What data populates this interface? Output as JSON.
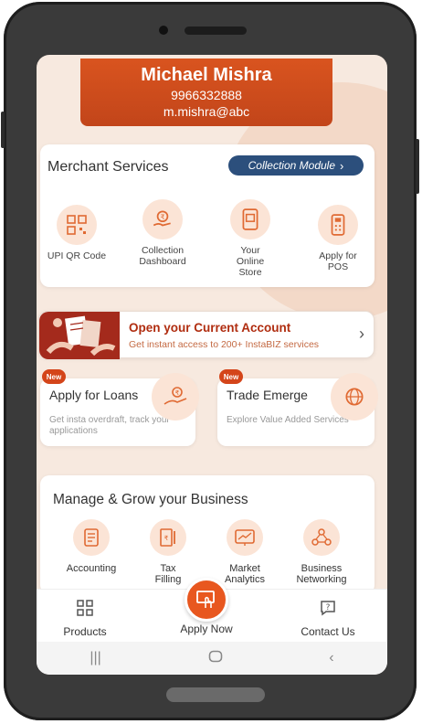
{
  "profile": {
    "name": "Michael Mishra",
    "phone": "9966332888",
    "email": "m.mishra@abc"
  },
  "merchant_services": {
    "title": "Merchant Services",
    "collection_button": "Collection Module",
    "items": [
      {
        "label": "UPI QR Code",
        "icon": "qr-code-icon"
      },
      {
        "label": "Collection Dashboard",
        "icon": "collection-dashboard-icon"
      },
      {
        "label": "Your Online Store",
        "icon": "online-store-icon"
      },
      {
        "label": "Apply for POS",
        "icon": "pos-machine-icon"
      }
    ]
  },
  "current_account": {
    "title": "Open your Current Account",
    "subtitle": "Get instant access to 200+ InstaBIZ services"
  },
  "loans": {
    "badge": "New",
    "title": "Apply for Loans",
    "subtitle": "Get insta overdraft, track your applications"
  },
  "trade": {
    "badge": "New",
    "title": "Trade Emerge",
    "subtitle": "Explore Value Added Services"
  },
  "grow": {
    "title": "Manage & Grow your Business",
    "items": [
      {
        "label": "Accounting",
        "icon": "accounting-icon"
      },
      {
        "label": "Tax Filling",
        "icon": "tax-filing-icon"
      },
      {
        "label": "Market Analytics",
        "icon": "market-analytics-icon"
      },
      {
        "label": "Business Networking",
        "icon": "business-networking-icon"
      }
    ]
  },
  "bottom_nav": {
    "products": "Products",
    "apply_now": "Apply Now",
    "contact_us": "Contact Us"
  },
  "colors": {
    "accent": "#e8571f",
    "profile_bg": "#c94a1b",
    "collection_button_bg": "#2c4f7c",
    "screen_bg": "#f7e9df"
  }
}
